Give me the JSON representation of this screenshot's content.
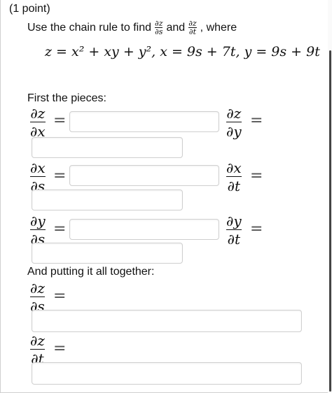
{
  "header": {
    "points": "(1 point)"
  },
  "intro": {
    "prefix": "Use the chain rule to find",
    "conj": "and",
    "suffix": ", where",
    "f1_num": "∂z",
    "f1_den": "∂s",
    "f2_num": "∂z",
    "f2_den": "∂t"
  },
  "equation": "z = x² + xy + y², x = 9s + 7t, y = 9s + 9t",
  "pieces": {
    "label": "First the pieces:",
    "dzdx": {
      "num": "∂z",
      "den": "∂x",
      "value": ""
    },
    "dzdy": {
      "num": "∂z",
      "den": "∂y",
      "value": ""
    },
    "dxds": {
      "num": "∂x",
      "den": "∂s",
      "value": ""
    },
    "dxdt": {
      "num": "∂x",
      "den": "∂t",
      "value": ""
    },
    "dyds": {
      "num": "∂y",
      "den": "∂s",
      "value": ""
    },
    "dydt": {
      "num": "∂y",
      "den": "∂t",
      "value": ""
    }
  },
  "together": {
    "label": "And putting it all together:",
    "dzds": {
      "num": "∂z",
      "den": "∂s",
      "value": ""
    },
    "dzdt": {
      "num": "∂z",
      "den": "∂t",
      "value": ""
    }
  },
  "eq_sign": "="
}
